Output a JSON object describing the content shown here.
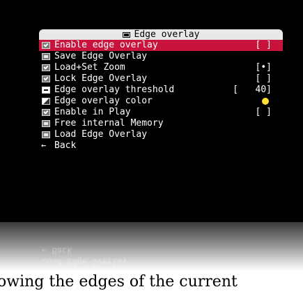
{
  "menu": {
    "title": "Edge overlay",
    "items": [
      {
        "label": "Enable edge overlay",
        "value": "[ ]",
        "icon": "checkbox-icon",
        "selected": true
      },
      {
        "label": "Save Edge Overlay",
        "value": "",
        "icon": "memory-card-icon"
      },
      {
        "label": "Load+Set Zoom",
        "value": "[•]",
        "icon": "checkbox-icon"
      },
      {
        "label": "Lock Edge Overlay",
        "value": "[ ]",
        "icon": "checkbox-icon"
      },
      {
        "label": "Edge overlay threshold",
        "value_open": "[",
        "value": "40]",
        "icon": "slider-icon"
      },
      {
        "label": "Edge overlay color",
        "value": "",
        "icon": "color-icon",
        "color": "#ffe033"
      },
      {
        "label": "Enable in Play",
        "value": "[ ]",
        "icon": "checkbox-icon"
      },
      {
        "label": "Free internal Memory",
        "value": "",
        "icon": "memory-card-icon"
      },
      {
        "label": "Load Edge Overlay",
        "value": "",
        "icon": "memory-card-icon"
      },
      {
        "label": "Back",
        "value": "",
        "icon": "back-arrow-icon"
      }
    ]
  },
  "reflection": {
    "line1": "← Back",
    "line2": "Load Edge Overlay"
  },
  "caption": "owing the edges of the current",
  "colors": {
    "selected_row": "#c8143c",
    "title_bar": "#e8e8e8",
    "screen_bg": "#000000",
    "overlay_color_swatch": "#ffe033"
  }
}
